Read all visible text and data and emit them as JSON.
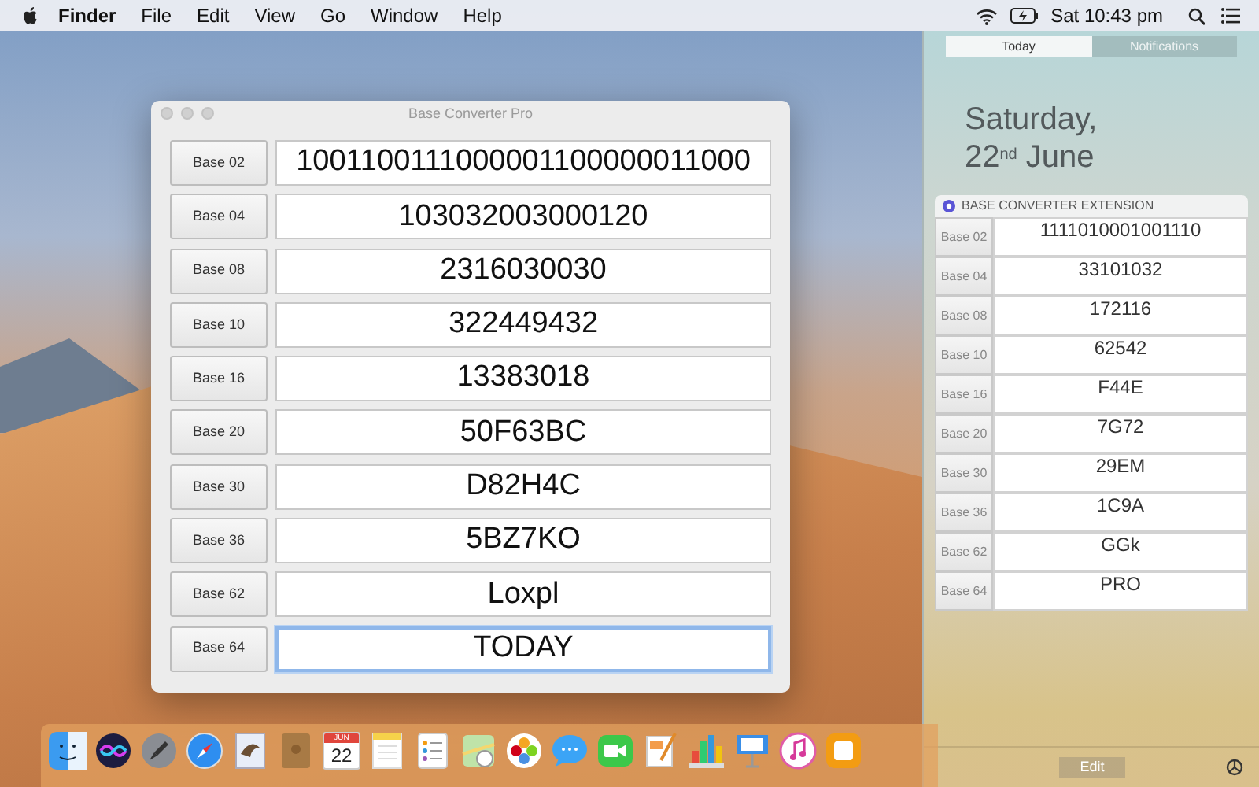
{
  "menu_bar": {
    "app": "Finder",
    "items": [
      "File",
      "Edit",
      "View",
      "Go",
      "Window",
      "Help"
    ],
    "clock": "Sat 10:43 pm"
  },
  "window": {
    "title": "Base Converter Pro",
    "rows": [
      {
        "label": "Base 02",
        "value": "1001100111000001100000011000",
        "focused": false
      },
      {
        "label": "Base 04",
        "value": "103032003000120",
        "focused": false
      },
      {
        "label": "Base 08",
        "value": "2316030030",
        "focused": false
      },
      {
        "label": "Base 10",
        "value": "322449432",
        "focused": false
      },
      {
        "label": "Base 16",
        "value": "13383018",
        "focused": false
      },
      {
        "label": "Base 20",
        "value": "50F63BC",
        "focused": false
      },
      {
        "label": "Base 30",
        "value": "D82H4C",
        "focused": false
      },
      {
        "label": "Base 36",
        "value": "5BZ7KO",
        "focused": false
      },
      {
        "label": "Base 62",
        "value": "Loxpl",
        "focused": false
      },
      {
        "label": "Base 64",
        "value": "TODAY",
        "focused": true
      }
    ]
  },
  "notification_center": {
    "tabs": [
      {
        "label": "Today",
        "selected": true
      },
      {
        "label": "Notifications",
        "selected": false
      }
    ],
    "date_line_1": "Saturday,",
    "date_line_2": "22$^{nd}$ June",
    "widget": {
      "title": "BASE CONVERTER EXTENSION",
      "rows": [
        {
          "label": "Base 02",
          "value": "1111010001001110"
        },
        {
          "label": "Base 04",
          "value": "33101032"
        },
        {
          "label": "Base 08",
          "value": "172116"
        },
        {
          "label": "Base 10",
          "value": "62542"
        },
        {
          "label": "Base 16",
          "value": "F44E"
        },
        {
          "label": "Base 20",
          "value": "7G72"
        },
        {
          "label": "Base 30",
          "value": "29EM"
        },
        {
          "label": "Base 36",
          "value": "1C9A"
        },
        {
          "label": "Base 62",
          "value": "GGk"
        },
        {
          "label": "Base 64",
          "value": "PRO"
        }
      ]
    },
    "edit_button": "Edit"
  },
  "dock": {
    "calendar_month": "JUN",
    "calendar_day": "22"
  }
}
